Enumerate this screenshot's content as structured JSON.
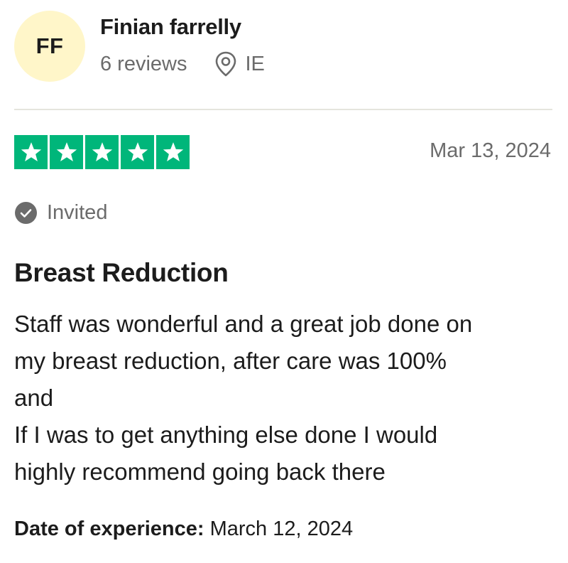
{
  "reviewer": {
    "initials": "FF",
    "name": "Finian farrelly",
    "review_count": "6 reviews",
    "country": "IE"
  },
  "review": {
    "rating": 5,
    "rating_max": 5,
    "date": "Mar 13, 2024",
    "invited_label": "Invited",
    "title": "Breast Reduction",
    "body_lines": [
      "Staff was wonderful and a great job done on",
      "my breast reduction, after care was 100%",
      "and",
      "If I was to get anything else done I would",
      "highly recommend going back there"
    ],
    "experience_label": "Date of experience:",
    "experience_date": "March 12, 2024"
  },
  "colors": {
    "star_fill": "#00b67a",
    "avatar_bg": "#fff6c9",
    "muted_text": "#6b6b6b",
    "divider": "#e5e5dd"
  },
  "icons": {
    "location": "location-pin-icon",
    "verified": "check-circle-icon",
    "star": "star-icon"
  }
}
